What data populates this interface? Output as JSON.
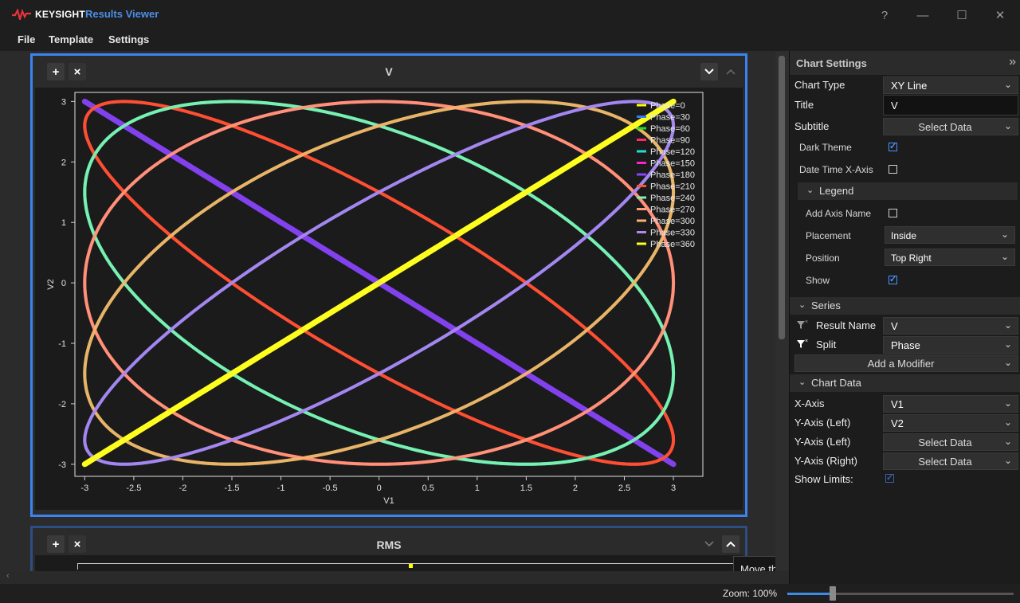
{
  "app": {
    "brand": "KEYSIGHT",
    "title": "Results Viewer",
    "help_glyph": "?",
    "minimize_glyph": "—",
    "maximize_glyph": "☐",
    "close_glyph": "✕"
  },
  "menu": [
    "File",
    "Template",
    "Settings"
  ],
  "panels": {
    "v": {
      "title": "V",
      "add_glyph": "+",
      "remove_glyph": "×",
      "collapse_glyph": "⌄",
      "up_glyph": "⌃"
    },
    "rms": {
      "title": "RMS",
      "add_glyph": "+",
      "remove_glyph": "×",
      "collapse_glyph": "⌄",
      "up_glyph": "⌃"
    }
  },
  "tooltip": "Move the chart up.",
  "status": {
    "zoom_label": "Zoom: 100%",
    "zoom_level": 0.2
  },
  "settings": {
    "header": "Chart Settings",
    "collapse_glyph": "»",
    "chart_type_label": "Chart Type",
    "chart_type_value": "XY Line",
    "title_label": "Title",
    "title_value": "V",
    "subtitle_label": "Subtitle",
    "subtitle_value": "Select Data",
    "dark_theme_label": "Dark Theme",
    "dark_theme_checked": true,
    "datetime_label": "Date Time X-Axis",
    "datetime_checked": false,
    "legend_section": "Legend",
    "add_axis_name_label": "Add Axis Name",
    "add_axis_name_checked": false,
    "placement_label": "Placement",
    "placement_value": "Inside",
    "position_label": "Position",
    "position_value": "Top Right",
    "show_label": "Show",
    "show_checked": true,
    "series_section": "Series",
    "result_name_label": "Result Name",
    "result_name_value": "V",
    "split_label": "Split",
    "split_value": "Phase",
    "add_modifier_label": "Add a Modifier",
    "chart_data_section": "Chart Data",
    "x_axis_label": "X-Axis",
    "x_axis_value": "V1",
    "y_left_label": "Y-Axis (Left)",
    "y_left_value": "V2",
    "y_left2_label": "Y-Axis (Left)",
    "y_left2_value": "Select Data",
    "y_right_label": "Y-Axis (Right)",
    "y_right_value": "Select Data",
    "show_limits_label": "Show Limits:",
    "show_limits_checked": true
  },
  "chart_data": {
    "type": "line",
    "title": "V",
    "xlabel": "V1",
    "ylabel": "V2",
    "xlim": [
      -3.1,
      3.3
    ],
    "ylim": [
      -3.2,
      3.15
    ],
    "xticks": [
      -3,
      -2.5,
      -2,
      -1.5,
      -1,
      -0.5,
      0,
      0.5,
      1,
      1.5,
      2,
      2.5,
      3
    ],
    "yticks": [
      -3,
      -2,
      -1,
      0,
      1,
      2,
      3
    ],
    "legend_placement": "top-right",
    "grid": false,
    "amplitude": 3,
    "series": [
      {
        "name": "Phase=0",
        "phase_deg": 0,
        "color": "#ffff00"
      },
      {
        "name": "Phase=30",
        "phase_deg": 30,
        "color": "#2f7bff"
      },
      {
        "name": "Phase=60",
        "phase_deg": 60,
        "color": "#22dd22"
      },
      {
        "name": "Phase=90",
        "phase_deg": 90,
        "color": "#ff2a6a"
      },
      {
        "name": "Phase=120",
        "phase_deg": 120,
        "color": "#22e0d0"
      },
      {
        "name": "Phase=150",
        "phase_deg": 150,
        "color": "#ff22cc"
      },
      {
        "name": "Phase=180",
        "phase_deg": 180,
        "color": "#8a44ff"
      },
      {
        "name": "Phase=210",
        "phase_deg": 210,
        "color": "#ff5522"
      },
      {
        "name": "Phase=240",
        "phase_deg": 240,
        "color": "#7ff2b0"
      },
      {
        "name": "Phase=270",
        "phase_deg": 270,
        "color": "#ff9a7a"
      },
      {
        "name": "Phase=300",
        "phase_deg": 300,
        "color": "#ffb070"
      },
      {
        "name": "Phase=330",
        "phase_deg": 330,
        "color": "#b088ee"
      },
      {
        "name": "Phase=360",
        "phase_deg": 360,
        "color": "#ffff22"
      }
    ]
  }
}
